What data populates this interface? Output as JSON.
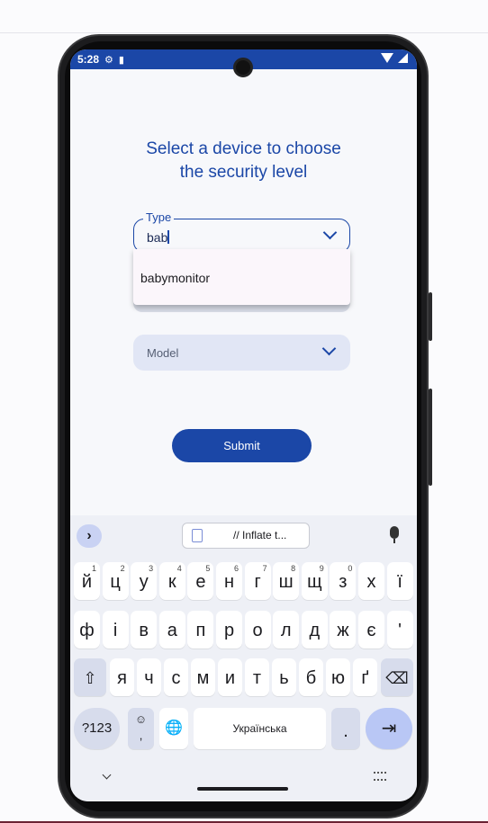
{
  "status": {
    "time": "5:28"
  },
  "screen": {
    "title_line1": "Select a device to choose",
    "title_line2": "the security level",
    "type_field": {
      "label": "Type",
      "value": "bab"
    },
    "dropdown": {
      "items": [
        "babymonitor"
      ]
    },
    "model_field": {
      "placeholder": "Model"
    },
    "submit_label": "Submit"
  },
  "keyboard": {
    "expand_icon": "›",
    "clipboard_text": "// Inflate t...",
    "row1": [
      {
        "k": "й",
        "h": "1"
      },
      {
        "k": "ц",
        "h": "2"
      },
      {
        "k": "у",
        "h": "3"
      },
      {
        "k": "к",
        "h": "4"
      },
      {
        "k": "е",
        "h": "5"
      },
      {
        "k": "н",
        "h": "6"
      },
      {
        "k": "г",
        "h": "7"
      },
      {
        "k": "ш",
        "h": "8"
      },
      {
        "k": "щ",
        "h": "9"
      },
      {
        "k": "з",
        "h": "0"
      },
      {
        "k": "х",
        "h": ""
      },
      {
        "k": "ї",
        "h": ""
      }
    ],
    "row2": [
      "ф",
      "і",
      "в",
      "а",
      "п",
      "р",
      "о",
      "л",
      "д",
      "ж",
      "є",
      "'"
    ],
    "row3": [
      "я",
      "ч",
      "с",
      "м",
      "и",
      "т",
      "ь",
      "б",
      "ю",
      "ґ"
    ],
    "symbols_label": "?123",
    "emoji_label": "☺",
    "comma_label": ",",
    "space_label": "Українська",
    "period_label": ".",
    "shift_icon": "⇧",
    "backspace_icon": "⌫",
    "enter_icon": "⇥",
    "globe_icon": "🌐"
  },
  "colors": {
    "accent": "#1b47a7",
    "keyboard_bg": "#eef0f6"
  }
}
